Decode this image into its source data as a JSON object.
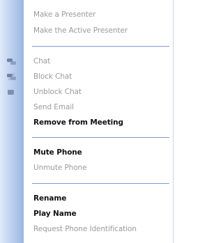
{
  "menu": {
    "items": [
      {
        "label": "Make a Presenter",
        "state": "disabled",
        "icon": ""
      },
      {
        "label": "Make the Active Presenter",
        "state": "disabled",
        "icon": ""
      },
      {
        "label": "Chat",
        "state": "disabled",
        "icon": "chat-bubbles-icon"
      },
      {
        "label": "Block Chat",
        "state": "disabled",
        "icon": "block-chat-icon"
      },
      {
        "label": "Unblock Chat",
        "state": "disabled",
        "icon": "unblock-chat-icon"
      },
      {
        "label": "Send Email",
        "state": "disabled",
        "icon": ""
      },
      {
        "label": "Remove from Meeting",
        "state": "enabled",
        "icon": ""
      },
      {
        "label": "Mute Phone",
        "state": "enabled",
        "icon": ""
      },
      {
        "label": "Unmute Phone",
        "state": "disabled",
        "icon": ""
      },
      {
        "label": "Rename",
        "state": "enabled",
        "icon": ""
      },
      {
        "label": "Play Name",
        "state": "enabled",
        "icon": ""
      },
      {
        "label": "Request Phone Identification",
        "state": "disabled",
        "icon": ""
      }
    ]
  },
  "colors": {
    "gutter": "#b9cdee",
    "separator": "#7f9ad3",
    "enabled_text": "#111111",
    "disabled_text": "#9a9a9a"
  }
}
